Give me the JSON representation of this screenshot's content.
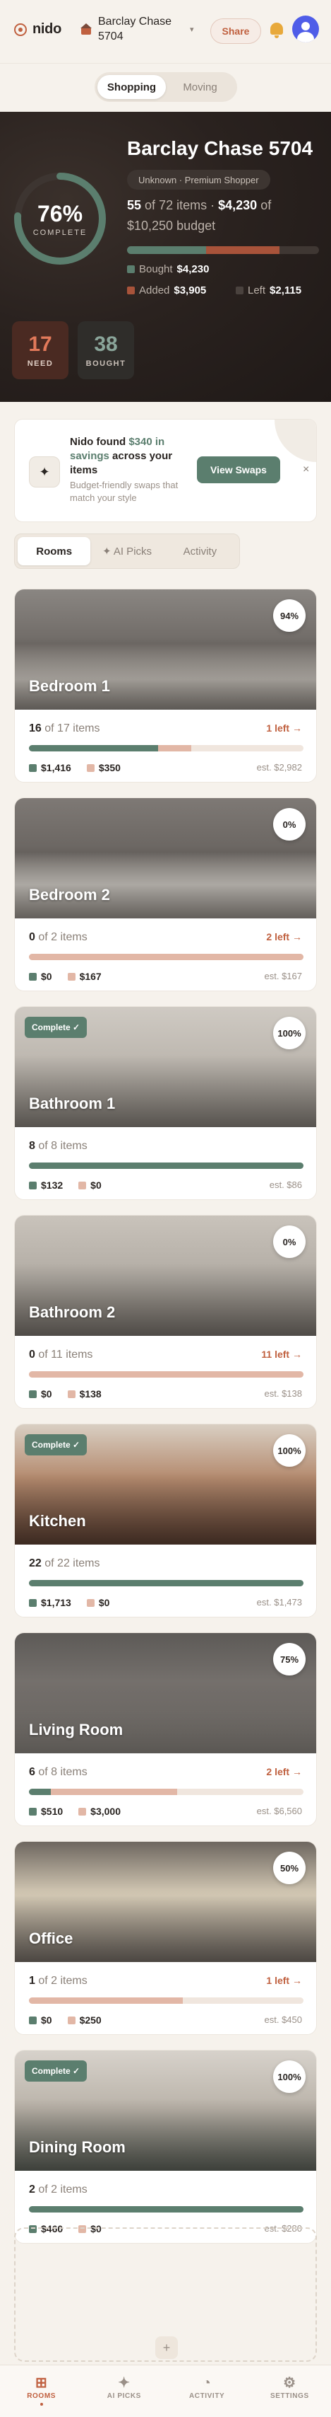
{
  "app": {
    "name": "nido",
    "project_name": "Barclay Chase 5704",
    "share_label": "Share"
  },
  "mode_toggle": {
    "options": [
      "Shopping",
      "Moving"
    ],
    "selected": "Shopping"
  },
  "hero": {
    "complete_pct": "76%",
    "complete_label": "COMPLETE",
    "complete_value": 0.76,
    "title": "Barclay Chase 5704",
    "subtitle": "Unknown · Premium Shopper",
    "items_done": "55",
    "items_of": "of 72 items ·",
    "spent": "$4,230",
    "spent_of": "of",
    "budget_text": "$10,250 budget",
    "budget_total": 10250,
    "bought_amount": 4230,
    "added_amount": 3905,
    "legend": {
      "bought_label": "Bought",
      "bought_value": "$4,230",
      "added_label": "Added",
      "added_value": "$3,905",
      "left_label": "Left",
      "left_value": "$2,115"
    },
    "stats": [
      {
        "value": "17",
        "label": "NEED"
      },
      {
        "value": "38",
        "label": "BOUGHT"
      }
    ]
  },
  "tip": {
    "title_prefix": "Nido found",
    "title_amount": "$340 in savings",
    "title_suffix": "across your items",
    "subtitle": "Budget-friendly swaps that match your style",
    "button": "View Swaps",
    "dismiss": "×"
  },
  "tabs": [
    {
      "label": "Rooms"
    },
    {
      "label": "✦ AI Picks"
    },
    {
      "label": "Activity"
    }
  ],
  "rooms": [
    {
      "name": "Bedroom 1",
      "badge": "94%",
      "complete": false,
      "complete_label": "",
      "done": "16",
      "of_text": "of 17 items",
      "left": "1 left →",
      "bought": "$1,416",
      "added": "$350",
      "est": "est. $2,982",
      "bought_frac": 0.47,
      "added_frac": 0.12
    },
    {
      "name": "Bedroom 2",
      "badge": "0%",
      "complete": false,
      "complete_label": "",
      "done": "0",
      "of_text": "of 2 items",
      "left": "2 left →",
      "bought": "$0",
      "added": "$167",
      "est": "est. $167",
      "bought_frac": 0.0,
      "added_frac": 1.0
    },
    {
      "name": "Bathroom 1",
      "badge": "100%",
      "complete": true,
      "complete_label": "Complete ✓",
      "done": "8",
      "of_text": "of 8 items",
      "left": "",
      "bought": "$132",
      "added": "$0",
      "est": "est. $86",
      "bought_frac": 1.0,
      "added_frac": 0.0
    },
    {
      "name": "Bathroom 2",
      "badge": "0%",
      "complete": false,
      "complete_label": "",
      "done": "0",
      "of_text": "of 11 items",
      "left": "11 left →",
      "bought": "$0",
      "added": "$138",
      "est": "est. $138",
      "bought_frac": 0.0,
      "added_frac": 1.0
    },
    {
      "name": "Kitchen",
      "badge": "100%",
      "complete": true,
      "complete_label": "Complete ✓",
      "done": "22",
      "of_text": "of 22 items",
      "left": "",
      "bought": "$1,713",
      "added": "$0",
      "est": "est. $1,473",
      "bought_frac": 1.0,
      "added_frac": 0.0
    },
    {
      "name": "Living Room",
      "badge": "75%",
      "complete": false,
      "complete_label": "",
      "done": "6",
      "of_text": "of 8 items",
      "left": "2 left →",
      "bought": "$510",
      "added": "$3,000",
      "est": "est. $6,560",
      "bought_frac": 0.08,
      "added_frac": 0.46
    },
    {
      "name": "Office",
      "badge": "50%",
      "complete": false,
      "complete_label": "",
      "done": "1",
      "of_text": "of 2 items",
      "left": "1 left →",
      "bought": "$0",
      "added": "$250",
      "est": "est. $450",
      "bought_frac": 0.0,
      "added_frac": 0.56
    },
    {
      "name": "Dining Room",
      "badge": "100%",
      "complete": true,
      "complete_label": "Complete ✓",
      "done": "2",
      "of_text": "of 2 items",
      "left": "",
      "bought": "$460",
      "added": "$0",
      "est": "est. $280",
      "bought_frac": 1.0,
      "added_frac": 0.0
    }
  ],
  "add_room_label": "+",
  "nav": [
    {
      "label": "ROOMS",
      "icon": "grid-icon"
    },
    {
      "label": "AI PICKS",
      "icon": "sparkle-icon"
    },
    {
      "label": "ACTIVITY",
      "icon": "activity-icon"
    },
    {
      "label": "SETTINGS",
      "icon": "gear-icon"
    }
  ],
  "colors": {
    "accent": "#c0603f",
    "green": "#5b7e6e",
    "added": "#e2b7a6",
    "dark": "#221c19"
  }
}
